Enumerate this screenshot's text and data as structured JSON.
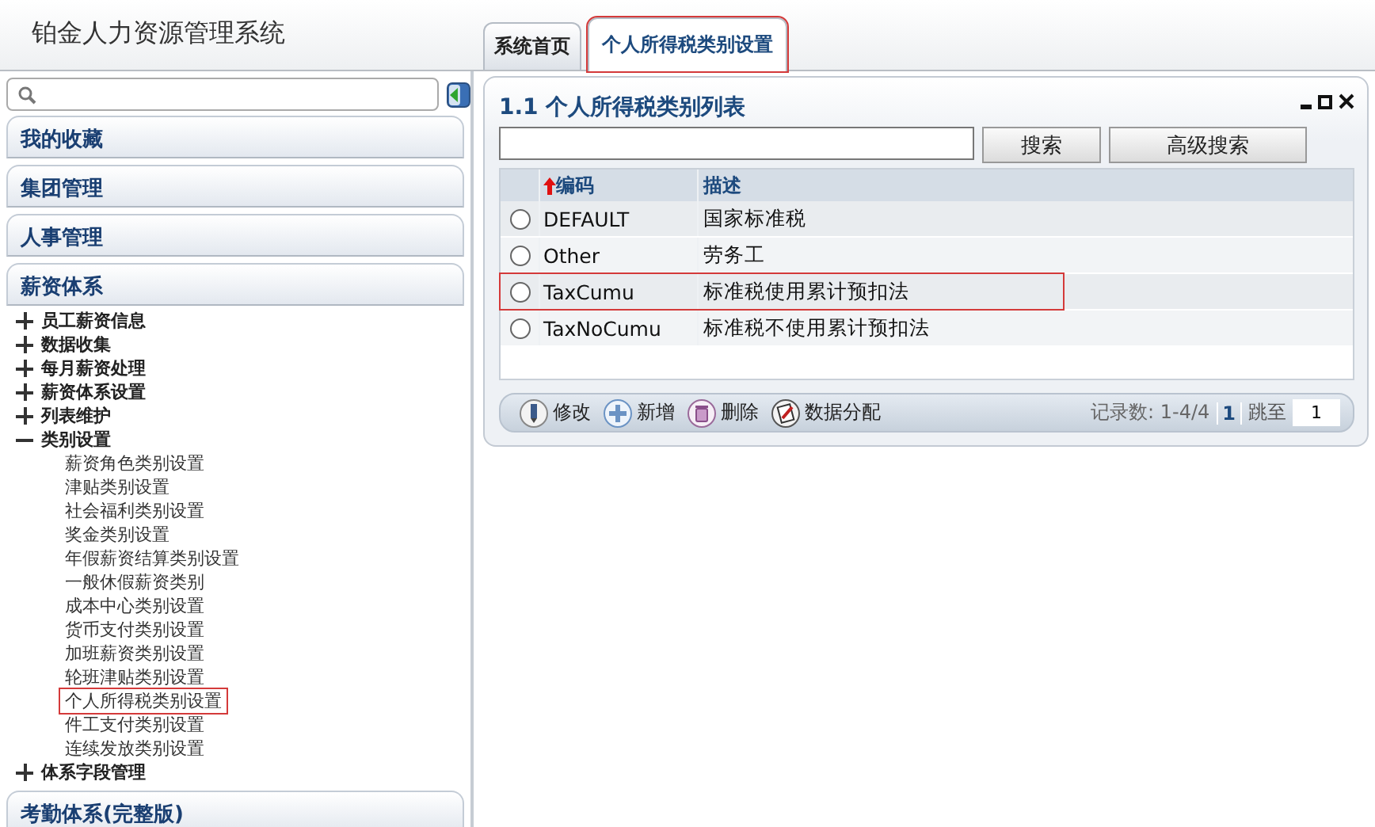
{
  "app_title": "铂金人力资源管理系统",
  "tabs": [
    {
      "label": "系统首页",
      "selected": false,
      "highlighted": false
    },
    {
      "label": "个人所得税类别设置",
      "selected": true,
      "highlighted": true
    }
  ],
  "sidebar": {
    "sections": [
      {
        "label": "我的收藏"
      },
      {
        "label": "集团管理"
      },
      {
        "label": "人事管理"
      },
      {
        "label": "薪资体系",
        "children": [
          {
            "kind": "group",
            "label": "员工薪资信息",
            "expanded": false
          },
          {
            "kind": "group",
            "label": "数据收集",
            "expanded": false
          },
          {
            "kind": "group",
            "label": "每月薪资处理",
            "expanded": false
          },
          {
            "kind": "group",
            "label": "薪资体系设置",
            "expanded": false
          },
          {
            "kind": "group",
            "label": "列表维护",
            "expanded": false
          },
          {
            "kind": "group",
            "label": "类别设置",
            "expanded": true,
            "children": [
              {
                "kind": "leaf",
                "label": "薪资角色类别设置",
                "highlighted": false
              },
              {
                "kind": "leaf",
                "label": "津贴类别设置",
                "highlighted": false
              },
              {
                "kind": "leaf",
                "label": "社会福利类别设置",
                "highlighted": false
              },
              {
                "kind": "leaf",
                "label": "奖金类别设置",
                "highlighted": false
              },
              {
                "kind": "leaf",
                "label": "年假薪资结算类别设置",
                "highlighted": false
              },
              {
                "kind": "leaf",
                "label": "一般休假薪资类别",
                "highlighted": false
              },
              {
                "kind": "leaf",
                "label": "成本中心类别设置",
                "highlighted": false
              },
              {
                "kind": "leaf",
                "label": "货币支付类别设置",
                "highlighted": false
              },
              {
                "kind": "leaf",
                "label": "加班薪资类别设置",
                "highlighted": false
              },
              {
                "kind": "leaf",
                "label": "轮班津贴类别设置",
                "highlighted": false
              },
              {
                "kind": "leaf",
                "label": "个人所得税类别设置",
                "highlighted": true
              },
              {
                "kind": "leaf",
                "label": "件工支付类别设置",
                "highlighted": false
              },
              {
                "kind": "leaf",
                "label": "连续发放类别设置",
                "highlighted": false
              }
            ]
          },
          {
            "kind": "group",
            "label": "体系字段管理",
            "expanded": false
          }
        ]
      },
      {
        "label": "考勤体系(完整版)"
      }
    ]
  },
  "panel": {
    "title": "1.1 个人所得税类别列表",
    "buttons": [
      "搜索",
      "高级搜索"
    ],
    "table": {
      "columns": [
        {
          "label": "编码",
          "sorted": true
        },
        {
          "label": "描述",
          "sorted": false
        }
      ],
      "rows": [
        {
          "code": "DEFAULT",
          "description": "国家标准税",
          "selected": false,
          "highlighted": false
        },
        {
          "code": "Other",
          "description": "劳务工",
          "selected": false,
          "highlighted": false
        },
        {
          "code": "TaxCumu",
          "description": "标准税使用累计预扣法",
          "selected": false,
          "highlighted": true
        },
        {
          "code": "TaxNoCumu",
          "description": "标准税不使用累计预扣法",
          "selected": false,
          "highlighted": false
        }
      ]
    },
    "actions": [
      {
        "kind": "edit",
        "label": "修改"
      },
      {
        "kind": "add",
        "label": "新增"
      },
      {
        "kind": "delete",
        "label": "删除"
      },
      {
        "kind": "assign",
        "label": "数据分配"
      }
    ],
    "record_count": "记录数: 1-4/4",
    "page": "1",
    "jump_label": "跳至",
    "jump_value": "1"
  }
}
